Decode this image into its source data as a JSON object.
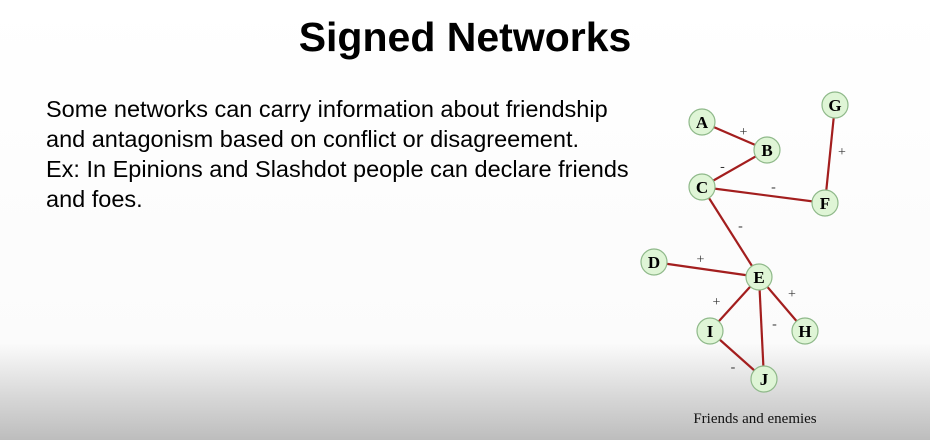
{
  "slide": {
    "title": "Signed Networks",
    "body_lines": [
      "Some networks can carry information about friendship and antagonism based on conflict or disagreement.",
      "Ex: In Epinions and Slashdot people can declare friends and foes."
    ],
    "caption": "Friends and enemies"
  },
  "diagram": {
    "node_fill": "#dff5d6",
    "node_stroke": "#8fb98a",
    "edge_color": "#a31e1e",
    "nodes": [
      "A",
      "B",
      "C",
      "D",
      "E",
      "F",
      "G",
      "H",
      "I",
      "J"
    ],
    "edges": [
      {
        "from": "A",
        "to": "B",
        "sign": "+"
      },
      {
        "from": "B",
        "to": "C",
        "sign": "-"
      },
      {
        "from": "C",
        "to": "F",
        "sign": "-"
      },
      {
        "from": "G",
        "to": "F",
        "sign": "+"
      },
      {
        "from": "C",
        "to": "E",
        "sign": "-"
      },
      {
        "from": "D",
        "to": "E",
        "sign": "+"
      },
      {
        "from": "E",
        "to": "I",
        "sign": "+"
      },
      {
        "from": "E",
        "to": "J",
        "sign": "-"
      },
      {
        "from": "E",
        "to": "H",
        "sign": "+"
      },
      {
        "from": "I",
        "to": "J",
        "sign": "-"
      }
    ]
  }
}
